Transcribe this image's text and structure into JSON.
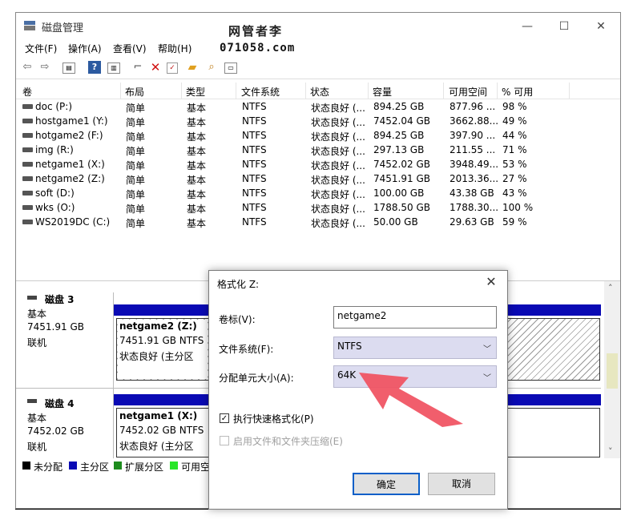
{
  "window": {
    "title": "磁盘管理",
    "watermark_line1": "网管者李",
    "watermark_line2": "071058.com",
    "controls": {
      "minimize": "—",
      "maximize": "☐",
      "close": "✕"
    }
  },
  "menu": [
    "文件(F)",
    "操作(A)",
    "查看(V)",
    "帮助(H)"
  ],
  "toolbar_icons": [
    "back-arrow-icon",
    "forward-arrow-icon",
    "disk-list-icon",
    "help-icon",
    "properties-icon",
    "connect-icon",
    "delete-icon",
    "check-icon",
    "folder-icon",
    "search-icon",
    "console-icon"
  ],
  "volume_table": {
    "columns": [
      "卷",
      "布局",
      "类型",
      "文件系统",
      "状态",
      "容量",
      "可用空间",
      "% 可用"
    ],
    "rows": [
      [
        "doc (P:)",
        "简单",
        "基本",
        "NTFS",
        "状态良好 (...",
        "894.25 GB",
        "877.96 ...",
        "98 %"
      ],
      [
        "hostgame1 (Y:)",
        "简单",
        "基本",
        "NTFS",
        "状态良好 (...",
        "7452.04 GB",
        "3662.88...",
        "49 %"
      ],
      [
        "hotgame2 (F:)",
        "简单",
        "基本",
        "NTFS",
        "状态良好 (...",
        "894.25 GB",
        "397.90 ...",
        "44 %"
      ],
      [
        "img (R:)",
        "简单",
        "基本",
        "NTFS",
        "状态良好 (...",
        "297.13 GB",
        "211.55 ...",
        "71 %"
      ],
      [
        "netgame1 (X:)",
        "简单",
        "基本",
        "NTFS",
        "状态良好 (...",
        "7452.02 GB",
        "3948.49...",
        "53 %"
      ],
      [
        "netgame2 (Z:)",
        "简单",
        "基本",
        "NTFS",
        "状态良好 (...",
        "7451.91 GB",
        "2013.36...",
        "27 %"
      ],
      [
        "soft (D:)",
        "简单",
        "基本",
        "NTFS",
        "状态良好 (...",
        "100.00 GB",
        "43.38 GB",
        "43 %"
      ],
      [
        "wks (O:)",
        "简单",
        "基本",
        "NTFS",
        "状态良好 (...",
        "1788.50 GB",
        "1788.30...",
        "100 %"
      ],
      [
        "WS2019DC (C:)",
        "简单",
        "基本",
        "NTFS",
        "状态良好 (...",
        "50.00 GB",
        "29.63 GB",
        "59 %"
      ]
    ]
  },
  "disks": [
    {
      "name": "磁盘 3",
      "type": "基本",
      "size": "7451.91 GB",
      "status": "联机",
      "partition": {
        "name": "netgame2  (Z:)",
        "size": "7451.91 GB NTFS",
        "status": "状态良好 (主分区"
      }
    },
    {
      "name": "磁盘 4",
      "type": "基本",
      "size": "7452.02 GB",
      "status": "联机",
      "partition": {
        "name": "netgame1  (X:)",
        "size": "7452.02 GB NTFS",
        "status": "状态良好 (主分区"
      }
    }
  ],
  "legend": [
    {
      "label": "未分配",
      "color": "#000000"
    },
    {
      "label": "主分区",
      "color": "#0a0ab4"
    },
    {
      "label": "扩展分区",
      "color": "#1e8c1e"
    },
    {
      "label": "可用空",
      "color": "#28e628"
    }
  ],
  "dialog": {
    "title": "格式化 Z:",
    "close": "✕",
    "volume_label": "卷标(V):",
    "volume_value": "netgame2",
    "fs_label": "文件系统(F):",
    "fs_value": "NTFS",
    "unit_label": "分配单元大小(A):",
    "unit_value": "64K",
    "quick_format": "执行快速格式化(P)",
    "compression": "启用文件和文件夹压缩(E)",
    "ok": "确定",
    "cancel": "取消"
  },
  "colors": {
    "accent_arrow": "#f0505f",
    "primary_partition": "#0a0ab4",
    "select_bg": "#dcdcf0"
  }
}
